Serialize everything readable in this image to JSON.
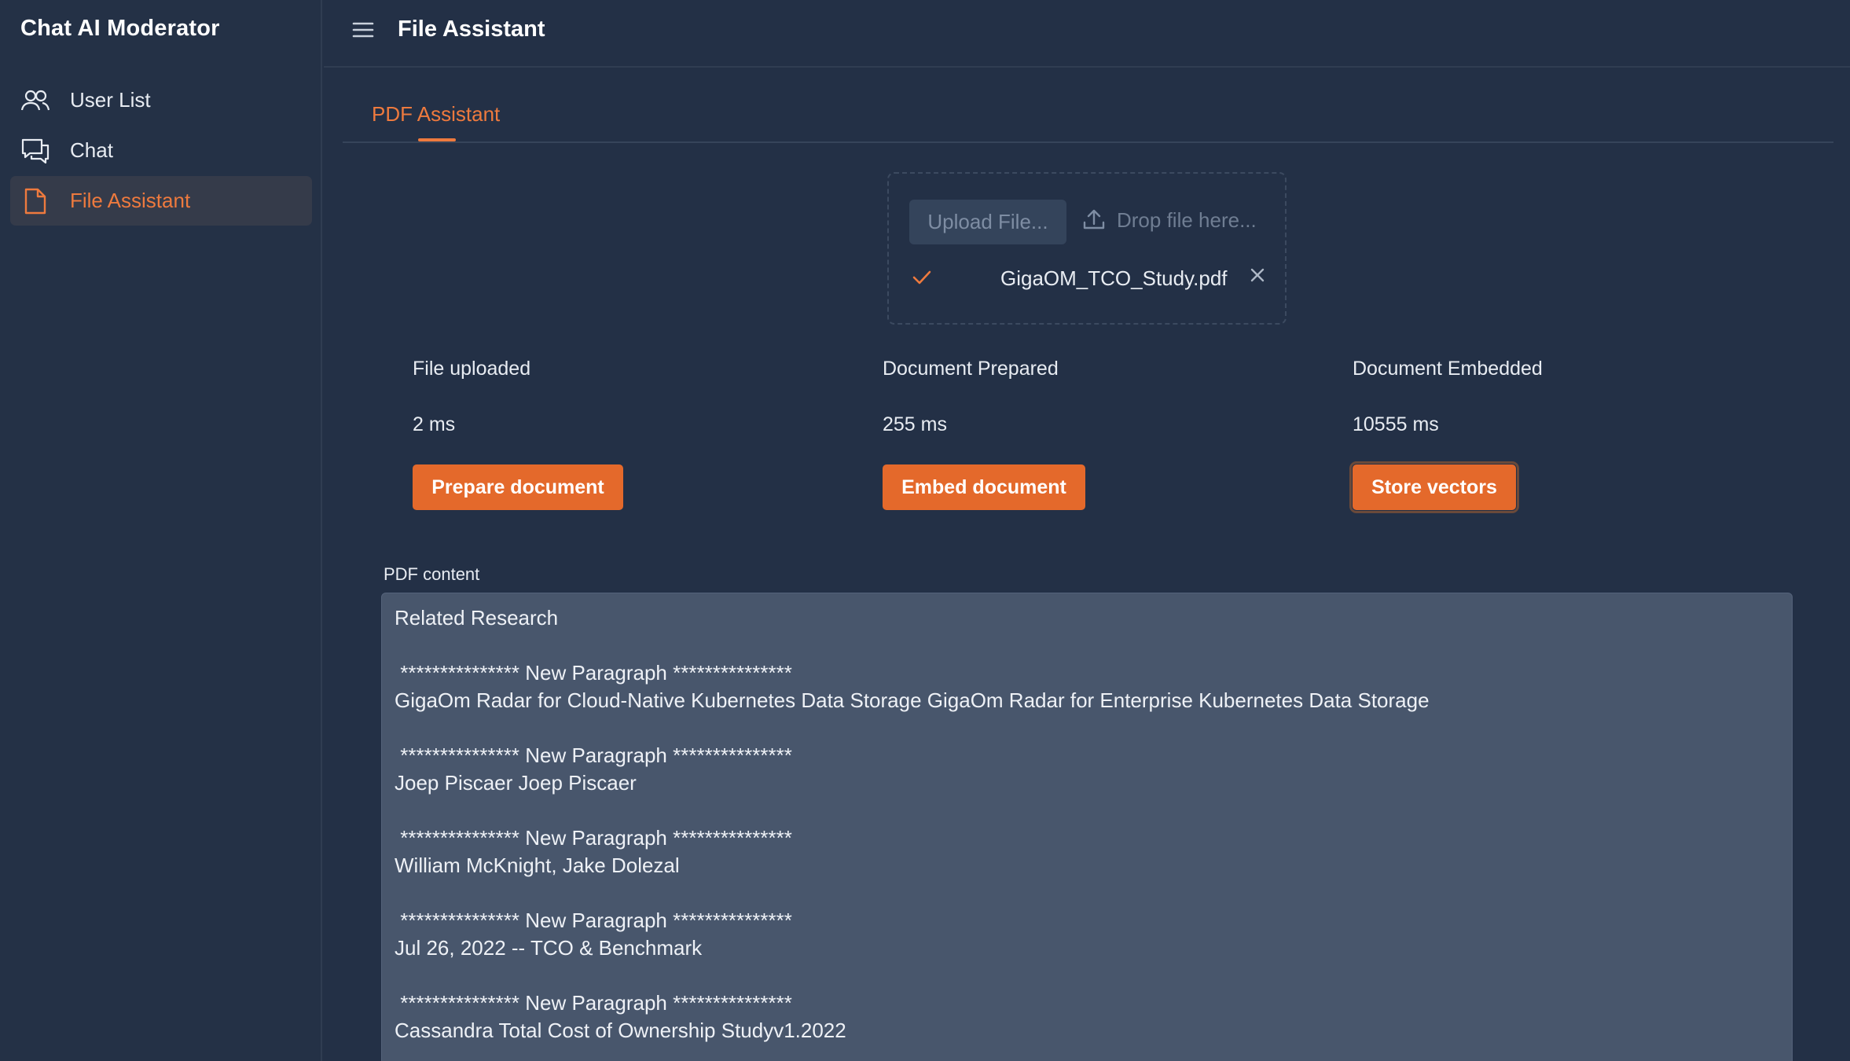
{
  "app": {
    "title": "Chat AI Moderator"
  },
  "sidebar": {
    "items": [
      {
        "label": "User List",
        "icon": "users-icon",
        "active": false
      },
      {
        "label": "Chat",
        "icon": "chat-icon",
        "active": false
      },
      {
        "label": "File Assistant",
        "icon": "file-icon",
        "active": true
      }
    ]
  },
  "header": {
    "title": "File Assistant",
    "menu_icon": "hamburger-icon"
  },
  "tabs": [
    {
      "label": "PDF Assistant",
      "active": true
    }
  ],
  "upload": {
    "button_label": "Upload File...",
    "drop_label": "Drop file here...",
    "file_name": "GigaOM_TCO_Study.pdf"
  },
  "status": [
    {
      "label": "File uploaded",
      "value": "2 ms",
      "button": "Prepare document"
    },
    {
      "label": "Document Prepared",
      "value": "255 ms",
      "button": "Embed document"
    },
    {
      "label": "Document Embedded",
      "value": "10555 ms",
      "button": "Store vectors"
    }
  ],
  "content": {
    "label": "PDF content",
    "text": "Related Research\n\n *************** New Paragraph ***************\nGigaOm Radar for Cloud-Native Kubernetes Data Storage GigaOm Radar for Enterprise Kubernetes Data Storage\n\n *************** New Paragraph ***************\nJoep Piscaer Joep Piscaer\n\n *************** New Paragraph ***************\nWilliam McKnight, Jake Dolezal\n\n *************** New Paragraph ***************\nJul 26, 2022 -- TCO & Benchmark\n\n *************** New Paragraph ***************\nCassandra Total Cost of Ownership Studyv1.2022"
  },
  "colors": {
    "accent": "#e4692b",
    "accent_text": "#ee7a3e",
    "background": "#233046",
    "content_bg": "#48566c"
  }
}
